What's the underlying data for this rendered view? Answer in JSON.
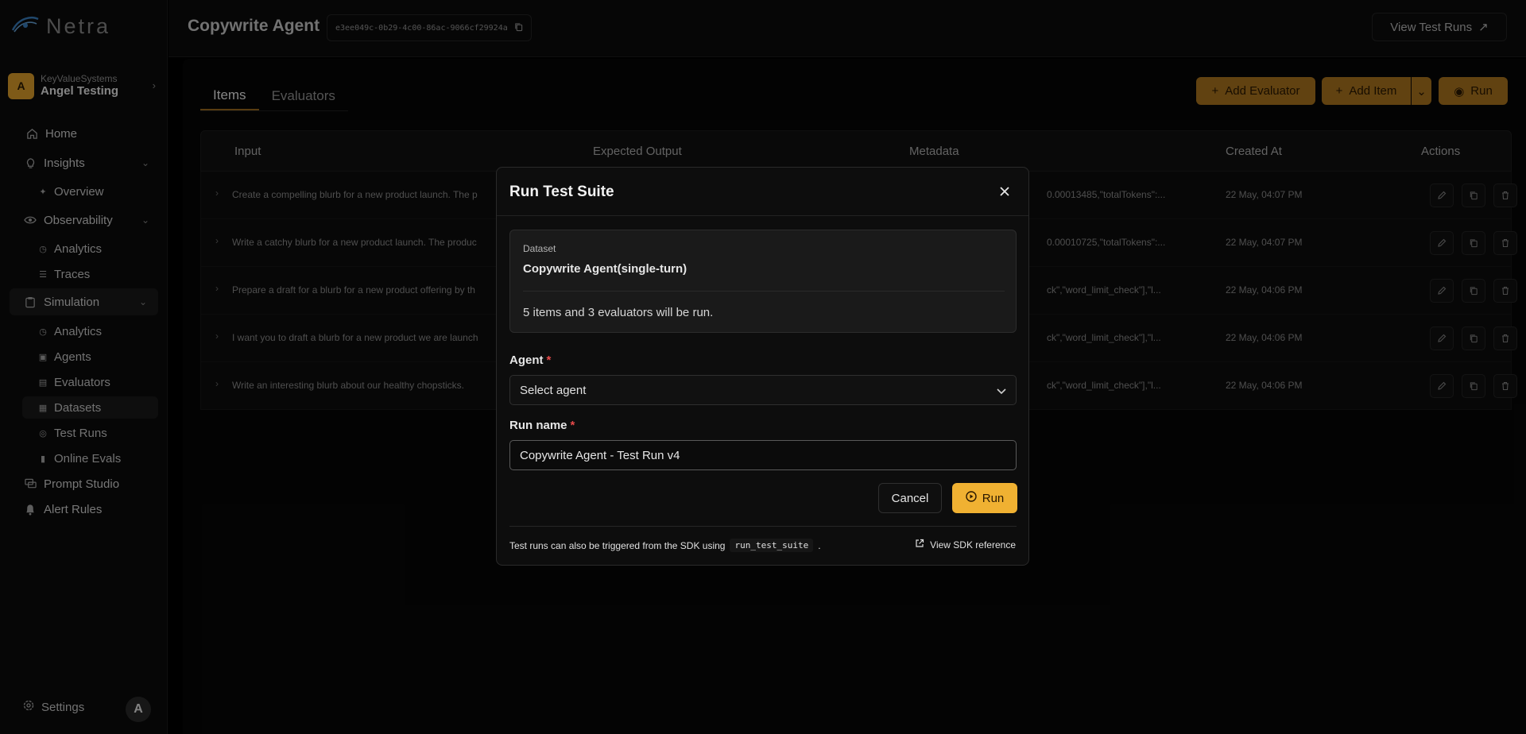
{
  "brand": {
    "logo_text": "Netra"
  },
  "org": {
    "avatar": "A",
    "sub": "KeyValueSystems",
    "name": "Angel Testing"
  },
  "nav": {
    "home": "Home",
    "insights": "Insights",
    "overview": "Overview",
    "observability": "Observability",
    "obs_analytics": "Analytics",
    "traces": "Traces",
    "simulation": "Simulation",
    "sim_analytics": "Analytics",
    "agents": "Agents",
    "evaluators": "Evaluators",
    "datasets": "Datasets",
    "test_runs": "Test Runs",
    "online_evals": "Online Evals",
    "prompt_studio": "Prompt Studio",
    "alert_rules": "Alert Rules",
    "settings": "Settings",
    "user_avatar": "A"
  },
  "header": {
    "title": "Copywrite Agent",
    "id": "e3ee049c-0b29-4c00-86ac-9066cf29924a",
    "view_test_runs": "View Test Runs"
  },
  "tabs": [
    {
      "label": "Items"
    },
    {
      "label": "Evaluators"
    }
  ],
  "toolbar": {
    "add_evaluator": "Add Evaluator",
    "add_item": "Add Item",
    "run": "Run"
  },
  "table": {
    "columns": [
      "Input",
      "Expected Output",
      "Metadata",
      "Created At",
      "Actions"
    ],
    "rows": [
      {
        "input": "Create a compelling blurb for a new product launch. The p",
        "metadata": "0.00013485,\"totalTokens\":...",
        "created": "22 May, 04:07 PM"
      },
      {
        "input": "Write a catchy blurb for a new product launch. The produc",
        "metadata": "0.00010725,\"totalTokens\":...",
        "created": "22 May, 04:07 PM"
      },
      {
        "input": "Prepare a draft for a blurb for a new product offering by th",
        "metadata": "ck\",\"word_limit_check\"],\"l...",
        "created": "22 May, 04:06 PM"
      },
      {
        "input": "I want you to draft a blurb for a new product we are launch",
        "metadata": "ck\",\"word_limit_check\"],\"l...",
        "created": "22 May, 04:06 PM"
      },
      {
        "input": "Write an interesting blurb about our healthy chopsticks.",
        "metadata": "ck\",\"word_limit_check\"],\"l...",
        "created": "22 May, 04:06 PM"
      }
    ]
  },
  "modal": {
    "title": "Run Test Suite",
    "dataset_label": "Dataset",
    "dataset_name": "Copywrite Agent(single-turn)",
    "summary": "5 items and 3 evaluators will be run.",
    "agent_label": "Agent",
    "agent_placeholder": "Select agent",
    "run_name_label": "Run name",
    "run_name_value": "Copywrite Agent - Test Run v4",
    "required_mark": "*",
    "cancel": "Cancel",
    "run": "Run",
    "footnote_text": "Test runs can also be triggered from the SDK using",
    "footnote_code": "run_test_suite",
    "footnote_end": ".",
    "sdk_link": "View SDK reference"
  },
  "colors": {
    "accent": "#f0b132",
    "accent_dark": "#b17820",
    "required": "#e84a4a"
  }
}
